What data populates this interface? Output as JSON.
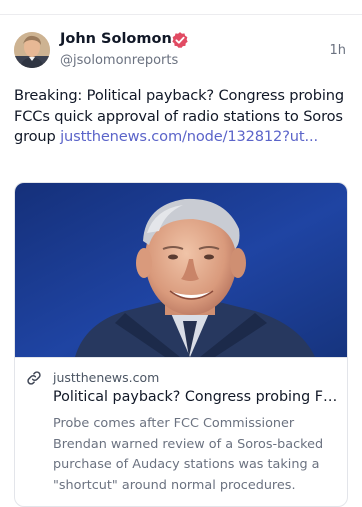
{
  "post": {
    "author_name": "John Solomon",
    "author_handle": "@jsolomonreports",
    "timestamp": "1h",
    "text": "Breaking: Political payback? Congress probing FCCs quick approval of radio stations to Soros group ",
    "link_text": "justthenews.com/node/132812?ut...",
    "verified": true,
    "icons": {
      "avatar": "avatar",
      "verified": "verified-badge-icon",
      "link": "link-icon"
    }
  },
  "link_card": {
    "domain": "justthenews.com",
    "title": "Political payback? Congress probing FCCs quick approval of radio stations to Soros group",
    "description": "Probe comes after FCC Commissioner Brendan warned review of a Soros-backed purchase of Audacy stations was taking a \"shortcut\" around normal procedures."
  },
  "colors": {
    "link": "#5b64c9",
    "verified_badge": "#e14b63",
    "muted_text": "#6b7280",
    "card_border": "#e3e5ea"
  }
}
